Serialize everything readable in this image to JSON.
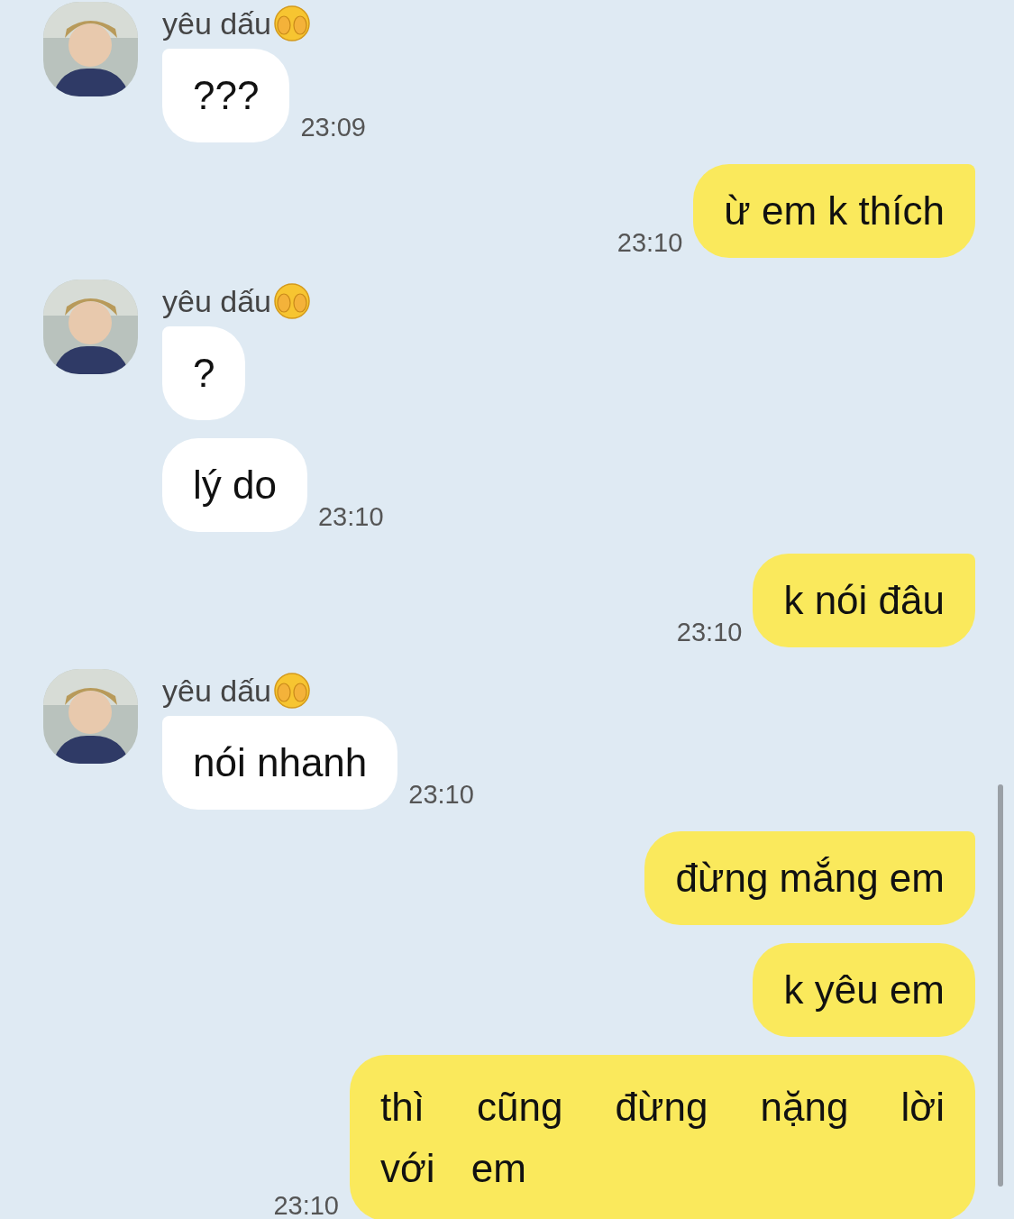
{
  "messages": [
    {
      "kind": "incoming",
      "sender": "yêu dấu",
      "bubbles": [
        "???"
      ],
      "time": "23:09"
    },
    {
      "kind": "outgoing",
      "bubbles": [
        "ừ em k thích"
      ],
      "time": "23:10"
    },
    {
      "kind": "incoming",
      "sender": "yêu dấu",
      "bubbles": [
        "?",
        "lý do"
      ],
      "time": "23:10"
    },
    {
      "kind": "outgoing",
      "bubbles": [
        "k nói đâu"
      ],
      "time": "23:10"
    },
    {
      "kind": "incoming",
      "sender": "yêu dấu",
      "bubbles": [
        "nói nhanh"
      ],
      "time": "23:10"
    },
    {
      "kind": "outgoing",
      "bubbles": [
        "đừng mắng em",
        "k yêu em",
        "thì cũng đừng nặng lời với em"
      ],
      "time": "23:10"
    }
  ]
}
